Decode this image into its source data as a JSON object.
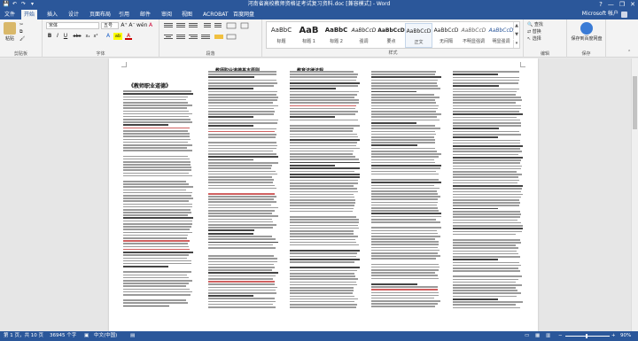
{
  "window": {
    "title": "河南省高校教师资格证考试复习资料.doc [兼容模式] - Word",
    "help": "?",
    "minimize": "—",
    "restore": "❐",
    "close": "✕"
  },
  "qat": {
    "save": "💾",
    "undo": "↶",
    "redo": "↷",
    "customize": "▾"
  },
  "tabs": [
    {
      "label": "文件"
    },
    {
      "label": "开始"
    },
    {
      "label": "插入"
    },
    {
      "label": "设计"
    },
    {
      "label": "页面布局"
    },
    {
      "label": "引用"
    },
    {
      "label": "邮件"
    },
    {
      "label": "审阅"
    },
    {
      "label": "视图"
    },
    {
      "label": "ACROBAT"
    },
    {
      "label": "百度网盘"
    }
  ],
  "account": {
    "name": "Microsoft 帐户"
  },
  "ribbon": {
    "clipboard": {
      "label": "剪贴板",
      "paste": "粘贴",
      "cut": "✂",
      "copy": "⧉",
      "format_painter": "🖌"
    },
    "font": {
      "label": "字体",
      "font_name": "宋体",
      "font_size": "五号",
      "bold": "B",
      "italic": "I",
      "underline": "U",
      "strike": "abc",
      "sub": "x₂",
      "sup": "x²",
      "font_color": "A",
      "highlight": "ab",
      "grow": "A⁺",
      "shrink": "A⁻",
      "clear": "A",
      "phonetic": "wén",
      "border_char": "A"
    },
    "paragraph": {
      "label": "段落"
    },
    "styles": {
      "label": "样式",
      "items": [
        {
          "sample": "AaBbC",
          "name": "标题"
        },
        {
          "sample": "AaB",
          "name": "标题 1"
        },
        {
          "sample": "AaBbC",
          "name": "标题 2"
        },
        {
          "sample": "AaBbCcD",
          "name": "强调"
        },
        {
          "sample": "AaBbCcD",
          "name": "要点"
        },
        {
          "sample": "AaBbCcD",
          "name": "正文"
        },
        {
          "sample": "AaBbCcD",
          "name": "无间隔"
        },
        {
          "sample": "AaBbCcD",
          "name": "不明显强调"
        },
        {
          "sample": "AaBbCcD",
          "name": "明显强调"
        }
      ]
    },
    "editing": {
      "label": "编辑",
      "find": "查找",
      "replace": "替换",
      "select": "选择"
    },
    "save_cloud": {
      "label": "保存",
      "button": "保存到百度网盘"
    }
  },
  "document": {
    "col1_title": "《教师职业道德》",
    "col2_title": "教师职业道德基本原则",
    "col3_title": "教育法律法规"
  },
  "status": {
    "page": "第 1 页，共 10 页",
    "words": "36945 个字",
    "lang": "中文(中国)",
    "zoom": "90%"
  }
}
